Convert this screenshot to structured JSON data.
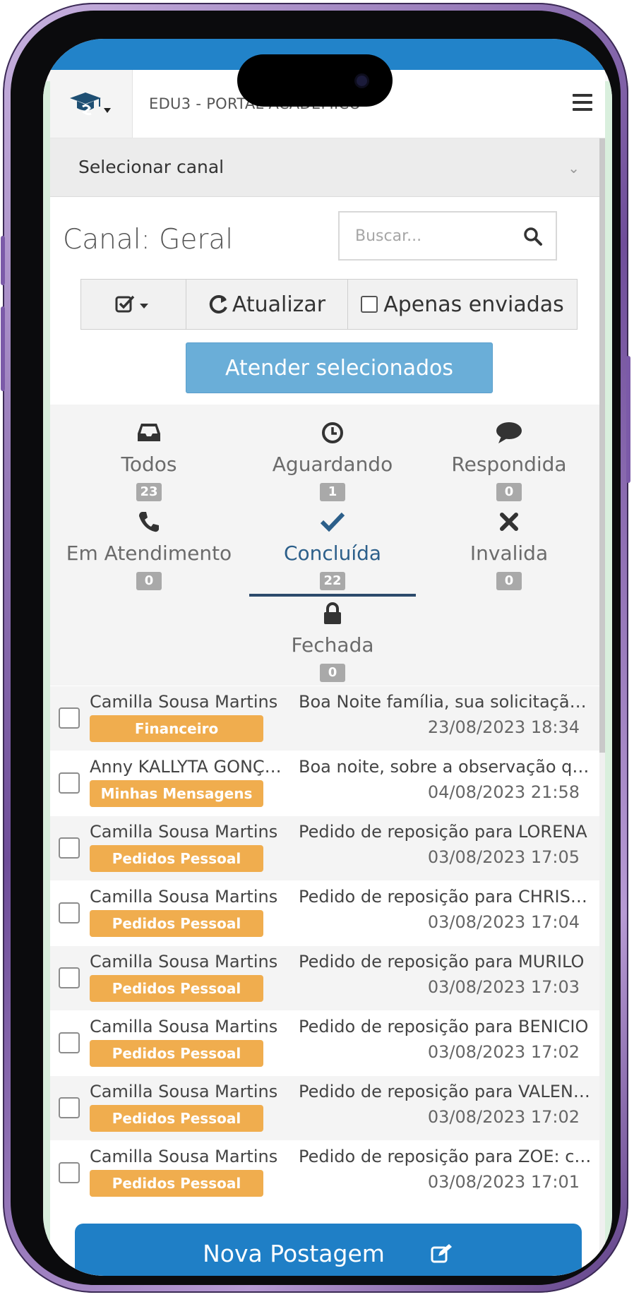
{
  "header": {
    "app_title": "EDU3 - PORTAL ACADÊMICO"
  },
  "channel_select": {
    "label": "Selecionar canal"
  },
  "channel": {
    "title": "Canal: Geral",
    "search_placeholder": "Buscar..."
  },
  "toolbar": {
    "refresh_label": "Atualizar",
    "only_sent_label": "Apenas enviadas",
    "attend_selected_label": "Atender selecionados"
  },
  "filters": [
    {
      "label": "Todos",
      "count": "23",
      "icon": "inbox-icon"
    },
    {
      "label": "Aguardando",
      "count": "1",
      "icon": "clock-icon"
    },
    {
      "label": "Respondida",
      "count": "0",
      "icon": "comment-icon"
    },
    {
      "label": "Em Atendimento",
      "count": "0",
      "icon": "phone-icon"
    },
    {
      "label": "Concluída",
      "count": "22",
      "icon": "check-icon",
      "active": true
    },
    {
      "label": "Invalida",
      "count": "0",
      "icon": "times-icon"
    },
    {
      "label": "Fechada",
      "count": "0",
      "icon": "lock-icon"
    }
  ],
  "messages": [
    {
      "sender": "Camilla Sousa Martins",
      "tag": "Financeiro",
      "preview": "Boa Noite família, sua solicitação foi atendida",
      "date": "23/08/2023 18:34"
    },
    {
      "sender": "Anny KALLYTA GONÇALVES",
      "tag": "Minhas Mensagens",
      "preview": "Boa noite, sobre a observação que foi feita",
      "date": "04/08/2023 21:58"
    },
    {
      "sender": "Camilla Sousa Martins",
      "tag": "Pedidos Pessoal",
      "preview": "Pedido de reposição para LORENA",
      "date": "03/08/2023 17:05"
    },
    {
      "sender": "Camilla Sousa Martins",
      "tag": "Pedidos Pessoal",
      "preview": "Pedido de reposição para CHRISTIAN",
      "date": "03/08/2023 17:04"
    },
    {
      "sender": "Camilla Sousa Martins",
      "tag": "Pedidos Pessoal",
      "preview": "Pedido de reposição para MURILO",
      "date": "03/08/2023 17:03"
    },
    {
      "sender": "Camilla Sousa Martins",
      "tag": "Pedidos Pessoal",
      "preview": "Pedido de reposição para BENICIO",
      "date": "03/08/2023 17:02"
    },
    {
      "sender": "Camilla Sousa Martins",
      "tag": "Pedidos Pessoal",
      "preview": "Pedido de reposição para VALENTINA",
      "date": "03/08/2023 17:02"
    },
    {
      "sender": "Camilla Sousa Martins",
      "tag": "Pedidos Pessoal",
      "preview": "Pedido de reposição para ZOE: conforme",
      "date": "03/08/2023 17:01"
    }
  ],
  "fab": {
    "label": "Nova Postagem"
  },
  "colors": {
    "brand_blue": "#1f7fc6",
    "tag_orange": "#f0ad4e",
    "primary_light": "#6aaed8",
    "active_filter": "#2c4a6b"
  }
}
